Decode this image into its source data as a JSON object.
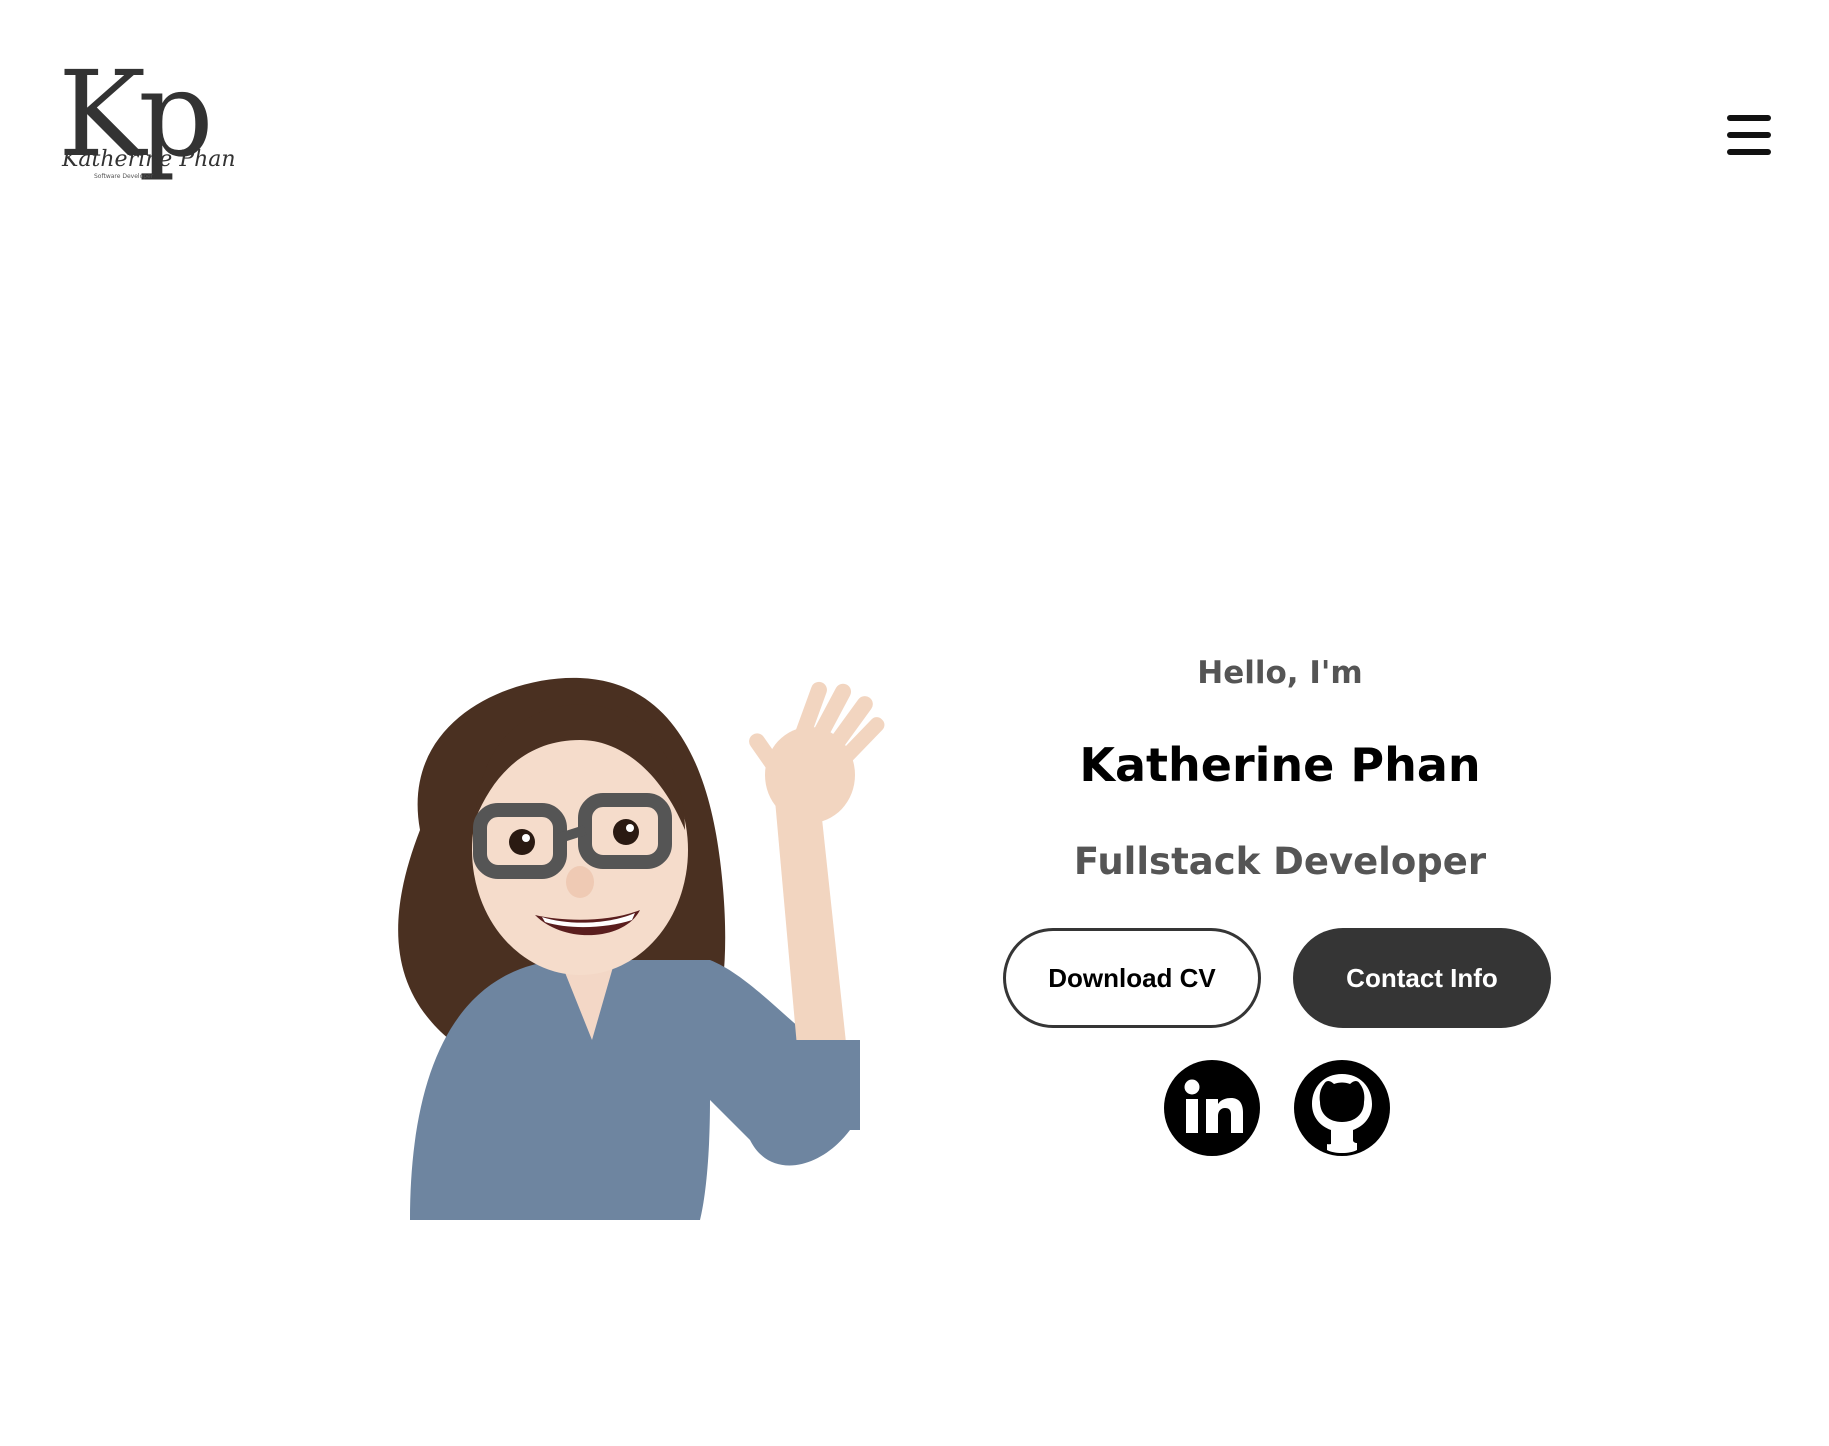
{
  "header": {
    "logo_monogram": "Kp",
    "logo_script": "Katherine Phan",
    "logo_subtitle": "Software Developer",
    "menu_icon": "hamburger-menu-icon"
  },
  "hero": {
    "avatar_icon": "waving-avatar-illustration",
    "greeting": "Hello, I'm",
    "name": "Katherine Phan",
    "role": "Fullstack Developer",
    "buttons": {
      "download_cv": "Download CV",
      "contact_info": "Contact Info"
    },
    "social": {
      "linkedin_icon": "linkedin-icon",
      "github_icon": "github-icon"
    }
  },
  "colors": {
    "text_dark": "#000000",
    "text_muted": "#555555",
    "button_dark": "#353535",
    "background": "#ffffff"
  }
}
